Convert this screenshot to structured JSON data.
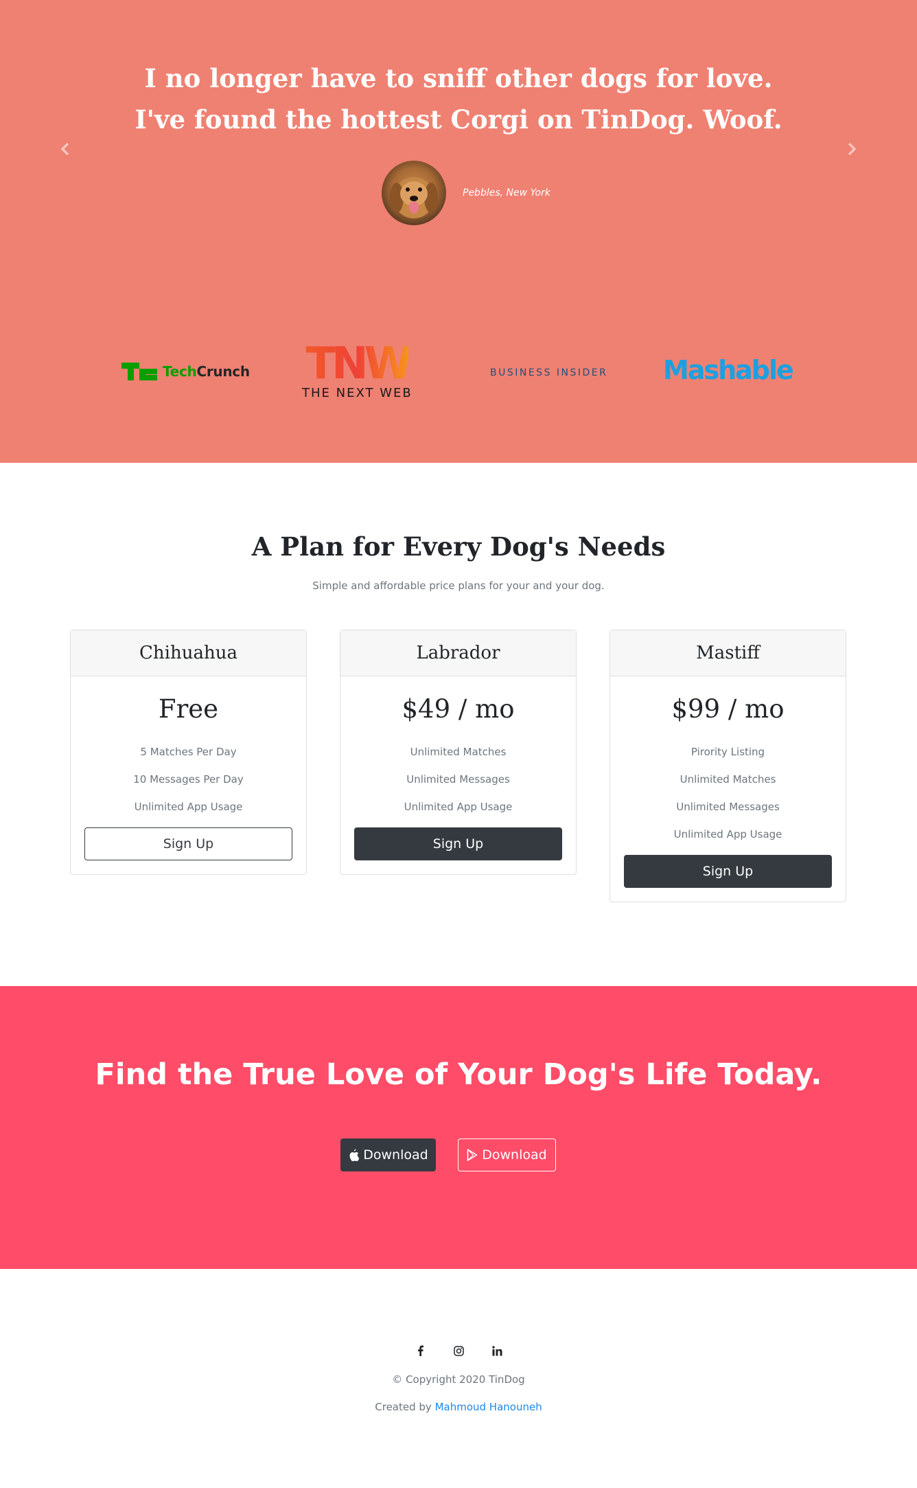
{
  "testimonial": {
    "quote": "I no longer have to sniff other dogs for love. I've found the hottest Corgi on TinDog. Woof.",
    "author": "Pebbles, New York",
    "prev_icon": "chevron-left-icon",
    "next_icon": "chevron-right-icon"
  },
  "press": {
    "techcrunch_a": "Tech",
    "techcrunch_b": "Crunch",
    "tnw_mark": "TNW",
    "tnw_sub": "THE NEXT WEB",
    "business_insider": "BUSINESS INSIDER",
    "mashable": "Mashable"
  },
  "pricing": {
    "title": "A Plan for Every Dog's Needs",
    "subtitle": "Simple and affordable price plans for your and your dog.",
    "plans": [
      {
        "name": "Chihuahua",
        "price": "Free",
        "features": [
          "5 Matches Per Day",
          "10 Messages Per Day",
          "Unlimited App Usage"
        ],
        "button": "Sign Up"
      },
      {
        "name": "Labrador",
        "price": "$49 / mo",
        "features": [
          "Unlimited Matches",
          "Unlimited Messages",
          "Unlimited App Usage"
        ],
        "button": "Sign Up"
      },
      {
        "name": "Mastiff",
        "price": "$99 / mo",
        "features": [
          "Pirority Listing",
          "Unlimited Matches",
          "Unlimited Messages",
          "Unlimited App Usage"
        ],
        "button": "Sign Up"
      }
    ]
  },
  "cta": {
    "title": "Find the True Love of Your Dog's Life Today.",
    "apple_button": "Download",
    "play_button": "Download"
  },
  "footer": {
    "copyright": "© Copyright 2020 TinDog",
    "credit_prefix": "Created by ",
    "credit_name": "Mahmoud Hanouneh"
  },
  "colors": {
    "testimonial_bg": "#ef8172",
    "cta_bg": "#ff4c68",
    "dark": "#343a40",
    "link": "#1e88e5"
  }
}
